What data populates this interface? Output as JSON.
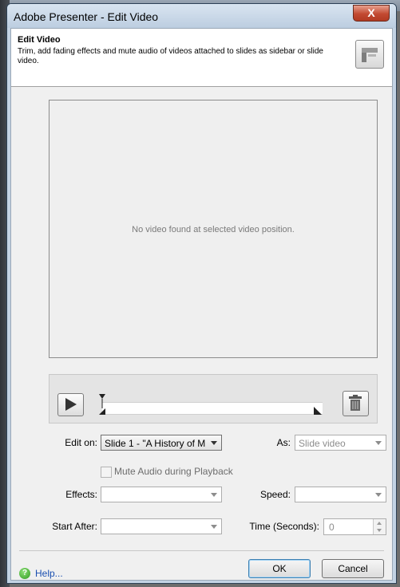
{
  "window": {
    "title": "Adobe Presenter - Edit Video",
    "close_label": "X"
  },
  "header": {
    "title": "Edit Video",
    "description": "Trim, add fading effects and mute audio of videos attached to slides as sidebar or slide video.",
    "icon": "video-edit-icon"
  },
  "video": {
    "message": "No video found at selected video position."
  },
  "timeline": {
    "play_icon": "play-icon",
    "delete_icon": "trash-icon"
  },
  "form": {
    "edit_on_label": "Edit on:",
    "edit_on_value": "Slide 1 - \"A History of M",
    "as_label": "As:",
    "as_value": "Slide video",
    "mute_label": "Mute Audio during Playback",
    "mute_checked": false,
    "effects_label": "Effects:",
    "effects_value": "",
    "speed_label": "Speed:",
    "speed_value": "",
    "start_after_label": "Start After:",
    "start_after_value": "",
    "time_label": "Time (Seconds):",
    "time_value": "0"
  },
  "footer": {
    "help_label": "Help...",
    "ok_label": "OK",
    "cancel_label": "Cancel"
  },
  "colors": {
    "title_bar": "#c3d3e4",
    "close_button": "#c24a32",
    "help_link": "#1a4fb0"
  }
}
